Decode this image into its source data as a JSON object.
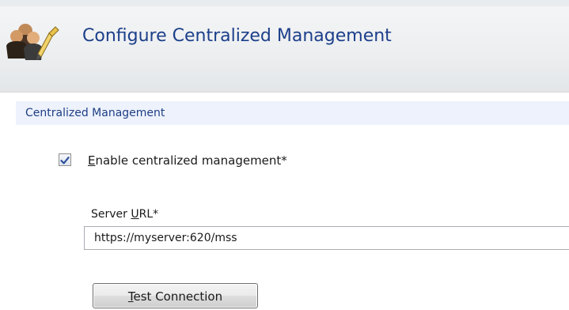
{
  "header": {
    "icon": "users-settings-icon",
    "title": "Configure Centralized Management"
  },
  "section": {
    "label": "Centralized Management"
  },
  "enable_option": {
    "checked": true,
    "label_mnemonic": "E",
    "label_rest": "nable centralized management*"
  },
  "server_url": {
    "label_prefix": "Server ",
    "label_mnemonic": "U",
    "label_rest": "RL*",
    "value": "https://myserver:620/mss"
  },
  "test_button": {
    "label_mnemonic": "T",
    "label_rest": "est Connection"
  },
  "colors": {
    "title": "#1c3f8a",
    "section_bar": "#eef2fc",
    "check_mark": "#2f4f9a"
  }
}
